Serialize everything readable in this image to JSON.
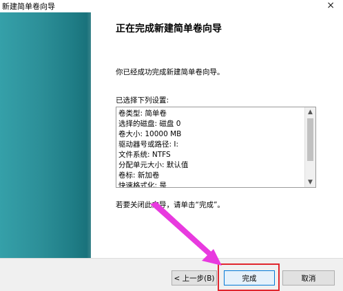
{
  "window": {
    "title": "新建简单卷向导",
    "close_glyph": "×"
  },
  "main": {
    "heading": "正在完成新建简单卷向导",
    "success_text": "你已经成功完成新建简单卷向导。",
    "settings_label": "已选择下列设置:",
    "settings_lines": [
      "卷类型: 简单卷",
      "选择的磁盘: 磁盘 0",
      "卷大小: 10000 MB",
      "驱动器号或路径: I:",
      "文件系统: NTFS",
      "分配单元大小: 默认值",
      "卷标: 新加卷",
      "快速格式化: 是"
    ],
    "finish_hint": "若要关闭此向导，请单击“完成”。"
  },
  "footer": {
    "back_label": "< 上一步(B)",
    "finish_label": "完成",
    "cancel_label": "取消"
  },
  "colors": {
    "banner": "#2c8f98",
    "highlight": "#e0242c",
    "arrow": "#e83adf"
  },
  "icons": {
    "scroll_up": "chevron-up-icon",
    "scroll_down": "chevron-down-icon",
    "close": "close-icon"
  }
}
